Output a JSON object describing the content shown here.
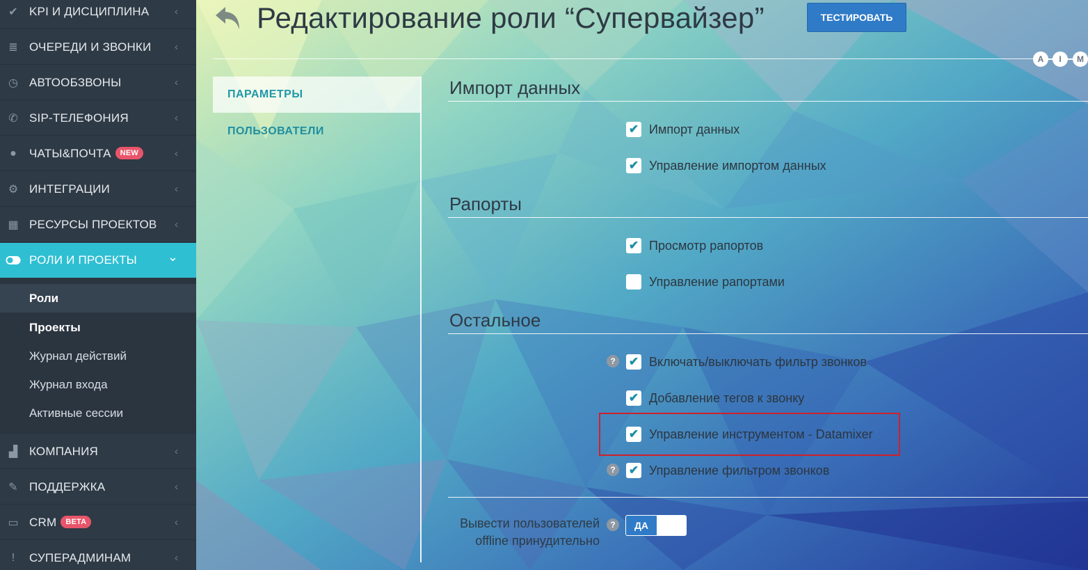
{
  "sidebar": {
    "items": [
      {
        "label": "KPI И ДИСЦИПЛИНА",
        "icon": "check-icon"
      },
      {
        "label": "ОЧЕРЕДИ И ЗВОНКИ",
        "icon": "list-icon"
      },
      {
        "label": "АВТООБЗВОНЫ",
        "icon": "clock-icon"
      },
      {
        "label": "SIP-ТЕЛЕФОНИЯ",
        "icon": "phone-icon"
      },
      {
        "label": "ЧАТЫ&ПОЧТА",
        "icon": "chat-icon",
        "badge": "NEW"
      },
      {
        "label": "ИНТЕГРАЦИИ",
        "icon": "gears-icon"
      },
      {
        "label": "РЕСУРСЫ ПРОЕКТОВ",
        "icon": "grid-icon"
      },
      {
        "label": "РОЛИ И ПРОЕКТЫ",
        "icon": "toggle-icon",
        "active": true
      },
      {
        "label": "КОМПАНИЯ",
        "icon": "bar-chart-icon"
      },
      {
        "label": "ПОДДЕРЖКА",
        "icon": "wrench-icon"
      },
      {
        "label": "CRM",
        "icon": "monitor-icon",
        "badge": "BETA"
      },
      {
        "label": "СУПЕРАДМИНАМ",
        "icon": "exclamation-icon"
      }
    ],
    "submenu": [
      "Роли",
      "Проекты",
      "Журнал действий",
      "Журнал входа",
      "Активные сессии"
    ]
  },
  "header": {
    "title": "Редактирование роли “Супервайзер”",
    "test_button": "ТЕСТИРОВАТЬ",
    "aim": [
      "A",
      "I",
      "M"
    ]
  },
  "tabs": [
    "ПАРАМЕТРЫ",
    "ПОЛЬЗОВАТЕЛИ"
  ],
  "sections": [
    {
      "title": "Импорт данных",
      "options": [
        {
          "label": "Импорт данных",
          "checked": true
        },
        {
          "label": "Управление импортом данных",
          "checked": true
        }
      ]
    },
    {
      "title": "Рапорты",
      "options": [
        {
          "label": "Просмотр рапортов",
          "checked": true
        },
        {
          "label": "Управление рапортами",
          "checked": false
        }
      ]
    },
    {
      "title": "Остальное",
      "options": [
        {
          "label": "Включать/выключать фильтр звонков",
          "checked": true,
          "help": true
        },
        {
          "label": "Добавление тегов к звонку",
          "checked": true
        },
        {
          "label": "Управление инструментом - Datamixer",
          "checked": true,
          "highlighted": true
        },
        {
          "label": "Управление фильтром звонков",
          "checked": true,
          "help": true
        }
      ]
    }
  ],
  "offline": {
    "label_line1": "Вывести пользователей",
    "label_line2": "offline принудительно",
    "toggle_value": "ДА"
  },
  "icons": {
    "checkmark": "✔",
    "help": "?",
    "chevron_left": "‹",
    "chevron_down": "⌄"
  },
  "colors": {
    "accent": "#2fbfd3",
    "button": "#2f7bc7",
    "badge": "#e8556a",
    "highlight": "#d0202a"
  }
}
